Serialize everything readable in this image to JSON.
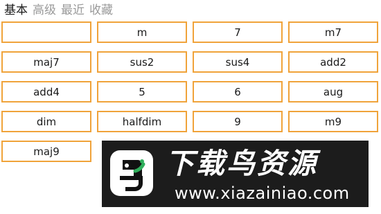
{
  "tabs": [
    {
      "label": "基本",
      "active": true
    },
    {
      "label": "高级",
      "active": false
    },
    {
      "label": "最近",
      "active": false
    },
    {
      "label": "收藏",
      "active": false
    }
  ],
  "chords": [
    "",
    "m",
    "7",
    "m7",
    "maj7",
    "sus2",
    "sus4",
    "add2",
    "add4",
    "5",
    "6",
    "aug",
    "dim",
    "halfdim",
    "9",
    "m9",
    "maj9"
  ],
  "watermark": {
    "text": "下载鸟资源",
    "url": "www.xiazainiao.com"
  },
  "colors": {
    "cell_border": "#f0a33a",
    "watermark_bg": "#1c1c1c",
    "logo_green": "#2fae5b"
  }
}
